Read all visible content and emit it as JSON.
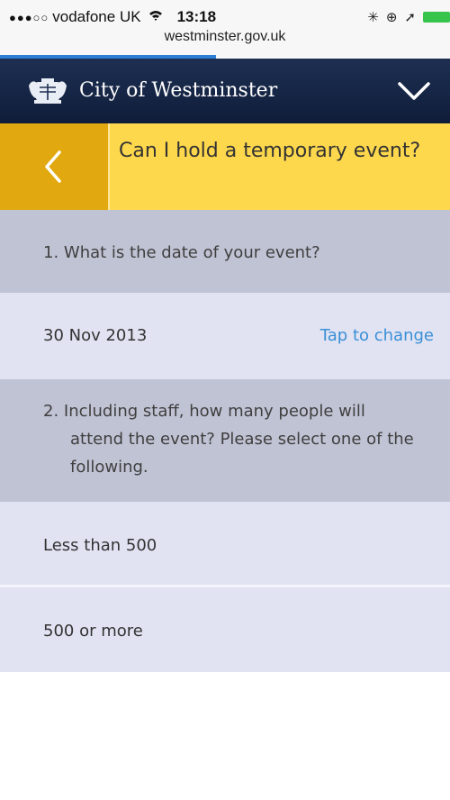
{
  "status_bar": {
    "signal": "●●●○○",
    "carrier": "vodafone UK",
    "wifi_icon": "wifi-icon",
    "time": "13:18",
    "url": "westminster.gov.uk",
    "load_progress": 0.48
  },
  "header": {
    "brand": "City of Westminster",
    "logo_icon": "crest-icon",
    "menu_icon": "chevron-down-icon"
  },
  "title_bar": {
    "title": "Can I hold a temporary event?",
    "back_icon": "chevron-left-icon"
  },
  "questions": [
    {
      "text": "1. What is the date of your event?",
      "answer": "30 Nov 2013",
      "action": "Tap to change"
    },
    {
      "text": "2. Including staff, how many people will attend the event? Please select one of the following.",
      "options": [
        "Less than 500",
        "500 or more"
      ]
    }
  ],
  "colors": {
    "header_bg": "#142447",
    "title_bg": "#fed84c",
    "back_bg": "#e1a80f",
    "question_bg": "#c0c3d4",
    "answer_bg": "#e1e3f3",
    "link": "#3a8fd6"
  }
}
